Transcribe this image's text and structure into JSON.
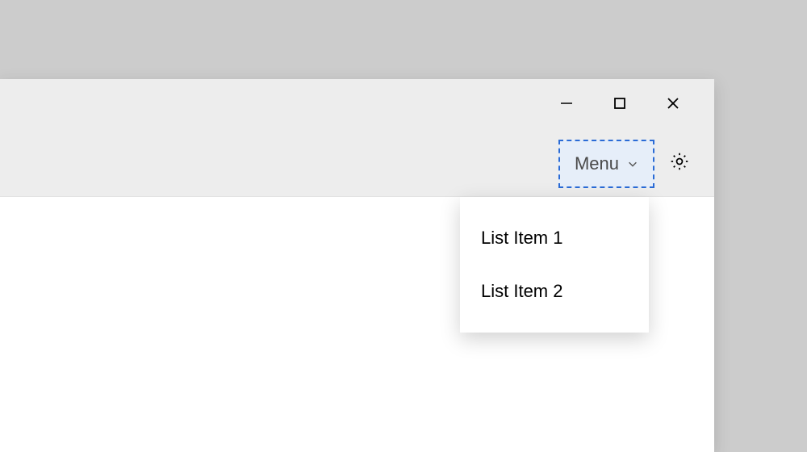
{
  "toolbar": {
    "menu_label": "Menu"
  },
  "dropdown": {
    "items": [
      {
        "label": "List Item 1"
      },
      {
        "label": "List Item 2"
      }
    ]
  }
}
